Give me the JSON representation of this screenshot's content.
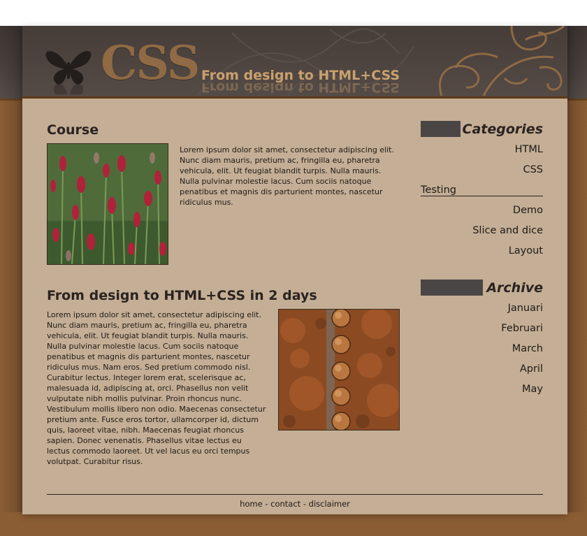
{
  "header": {
    "logo_text": "CSS",
    "tagline": "From design to HTML+CSS"
  },
  "posts": [
    {
      "title": "Course",
      "text": "Lorem ipsum dolor sit amet, consectetur adipiscing elit. Nunc diam mauris, pretium ac, fringilla eu, pharetra vehicula, elit. Ut feugiat blandit turpis. Nulla mauris. Nulla pulvinar molestie lacus. Cum sociis natoque penatibus et magnis dis parturient montes, nascetur ridiculus mus.",
      "image": "red clover flowers photo"
    },
    {
      "title": "From design to HTML+CSS in 2 days",
      "text": "Lorem ipsum dolor sit amet, consectetur adipiscing elit. Nunc diam mauris, pretium ac, fringilla eu, pharetra vehicula, elit. Ut feugiat blandit turpis. Nulla mauris. Nulla pulvinar molestie lacus. Cum sociis natoque penatibus et magnis dis parturient montes, nascetur ridiculus mus. Nam eros. Sed pretium commodo nisl. Curabitur lectus. Integer lorem erat, scelerisque ac, malesuada id, adipiscing at, orci. Phasellus non velit vulputate nibh mollis pulvinar. Proin rhoncus nunc. Vestibulum mollis libero non odio. Maecenas consectetur pretium ante. Fusce eros tortor, ullamcorper id, dictum quis, laoreet vitae, nibh. Maecenas feugiat rhoncus sapien. Donec venenatis. Phasellus vitae lectus eu lectus commodo laoreet. Ut vel lacus eu orci tempus volutpat. Curabitur risus.",
      "image": "rusty rivets photo"
    }
  ],
  "sidebar": {
    "categories": {
      "title": "Categories",
      "items": [
        "HTML",
        "CSS",
        "Testing",
        "Demo",
        "Slice and dice",
        "Layout"
      ]
    },
    "archive": {
      "title": "Archive",
      "items": [
        "Januari",
        "Februari",
        "March",
        "April",
        "May"
      ]
    }
  },
  "footer": {
    "home": "home",
    "contact": "contact",
    "disclaimer": "disclaimer",
    "separator": " - "
  },
  "colors": {
    "page_bg": "#8a5d34",
    "content_bg": "#c4ae95",
    "header_bg": "#4a423f",
    "accent": "#c9a16e"
  }
}
